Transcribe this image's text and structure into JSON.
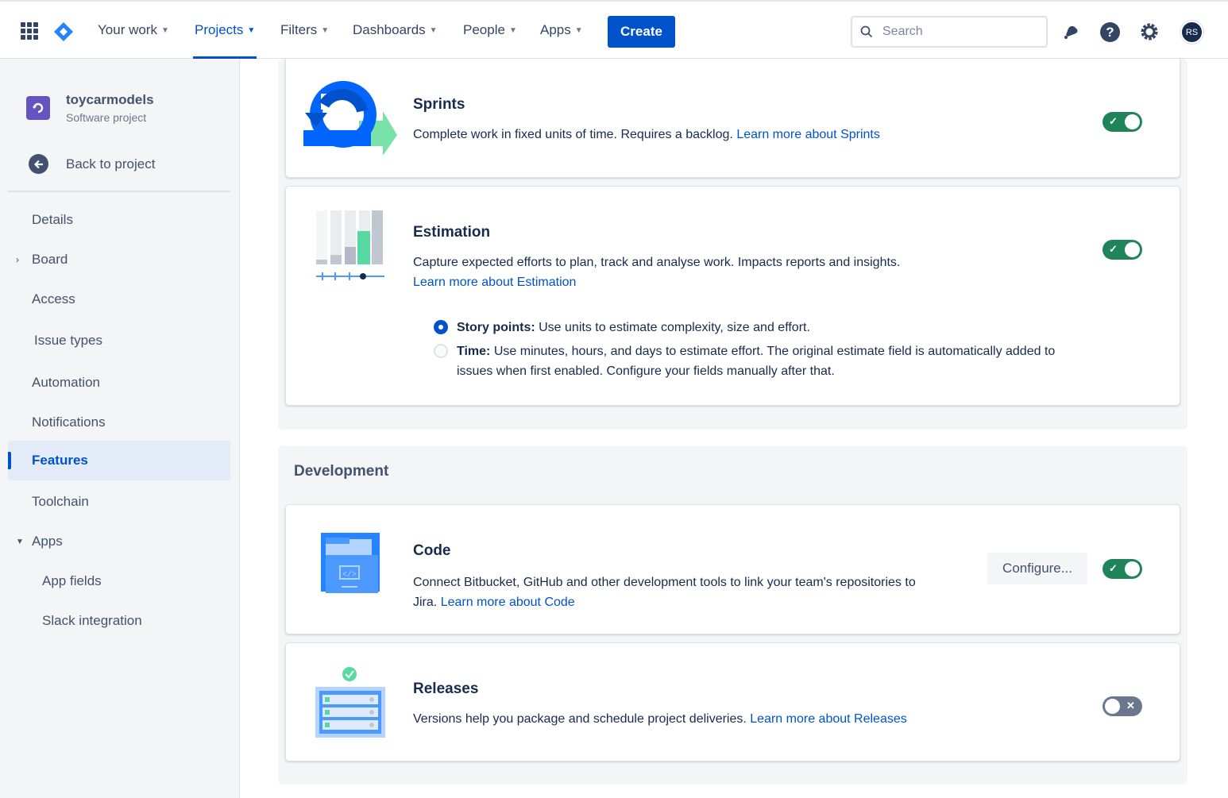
{
  "topnav": {
    "items": [
      {
        "label": "Your work"
      },
      {
        "label": "Projects"
      },
      {
        "label": "Filters"
      },
      {
        "label": "Dashboards"
      },
      {
        "label": "People"
      },
      {
        "label": "Apps"
      }
    ],
    "create_label": "Create",
    "search_placeholder": "Search",
    "avatar_initials": "RS"
  },
  "sidebar": {
    "project_name": "toycarmodels",
    "project_type": "Software project",
    "back_label": "Back to project",
    "items": [
      {
        "label": "Details"
      },
      {
        "label": "Board"
      },
      {
        "label": "Access"
      },
      {
        "label": "Issue types"
      },
      {
        "label": "Automation"
      },
      {
        "label": "Notifications"
      },
      {
        "label": "Features"
      },
      {
        "label": "Toolchain"
      },
      {
        "label": "Apps"
      },
      {
        "label": "App fields"
      },
      {
        "label": "Slack integration"
      }
    ]
  },
  "features": {
    "sprints": {
      "title": "Sprints",
      "desc": "Complete work in fixed units of time. Requires a backlog.",
      "link": "Learn more about Sprints",
      "enabled": true
    },
    "estimation": {
      "title": "Estimation",
      "desc": "Capture expected efforts to plan, track and analyse work. Impacts reports and insights.",
      "link": "Learn more about Estimation",
      "enabled": true,
      "options": [
        {
          "label": "Story points:",
          "desc": "Use units to estimate complexity, size and effort.",
          "selected": true
        },
        {
          "label": "Time:",
          "desc": "Use minutes, hours, and days to estimate effort. The original estimate field is automatically added to issues when first enabled. Configure your fields manually after that.",
          "selected": false
        }
      ]
    },
    "development_title": "Development",
    "code": {
      "title": "Code",
      "desc": "Connect Bitbucket, GitHub and other development tools to link your team's repositories to Jira.",
      "link": "Learn more about Code",
      "configure_label": "Configure...",
      "enabled": true
    },
    "releases": {
      "title": "Releases",
      "desc": "Versions help you package and schedule project deliveries.",
      "link": "Learn more about Releases",
      "enabled": false
    }
  },
  "colors": {
    "brand": "#0052cc",
    "toggle_on": "#1f845a",
    "toggle_off": "#6b778c"
  }
}
